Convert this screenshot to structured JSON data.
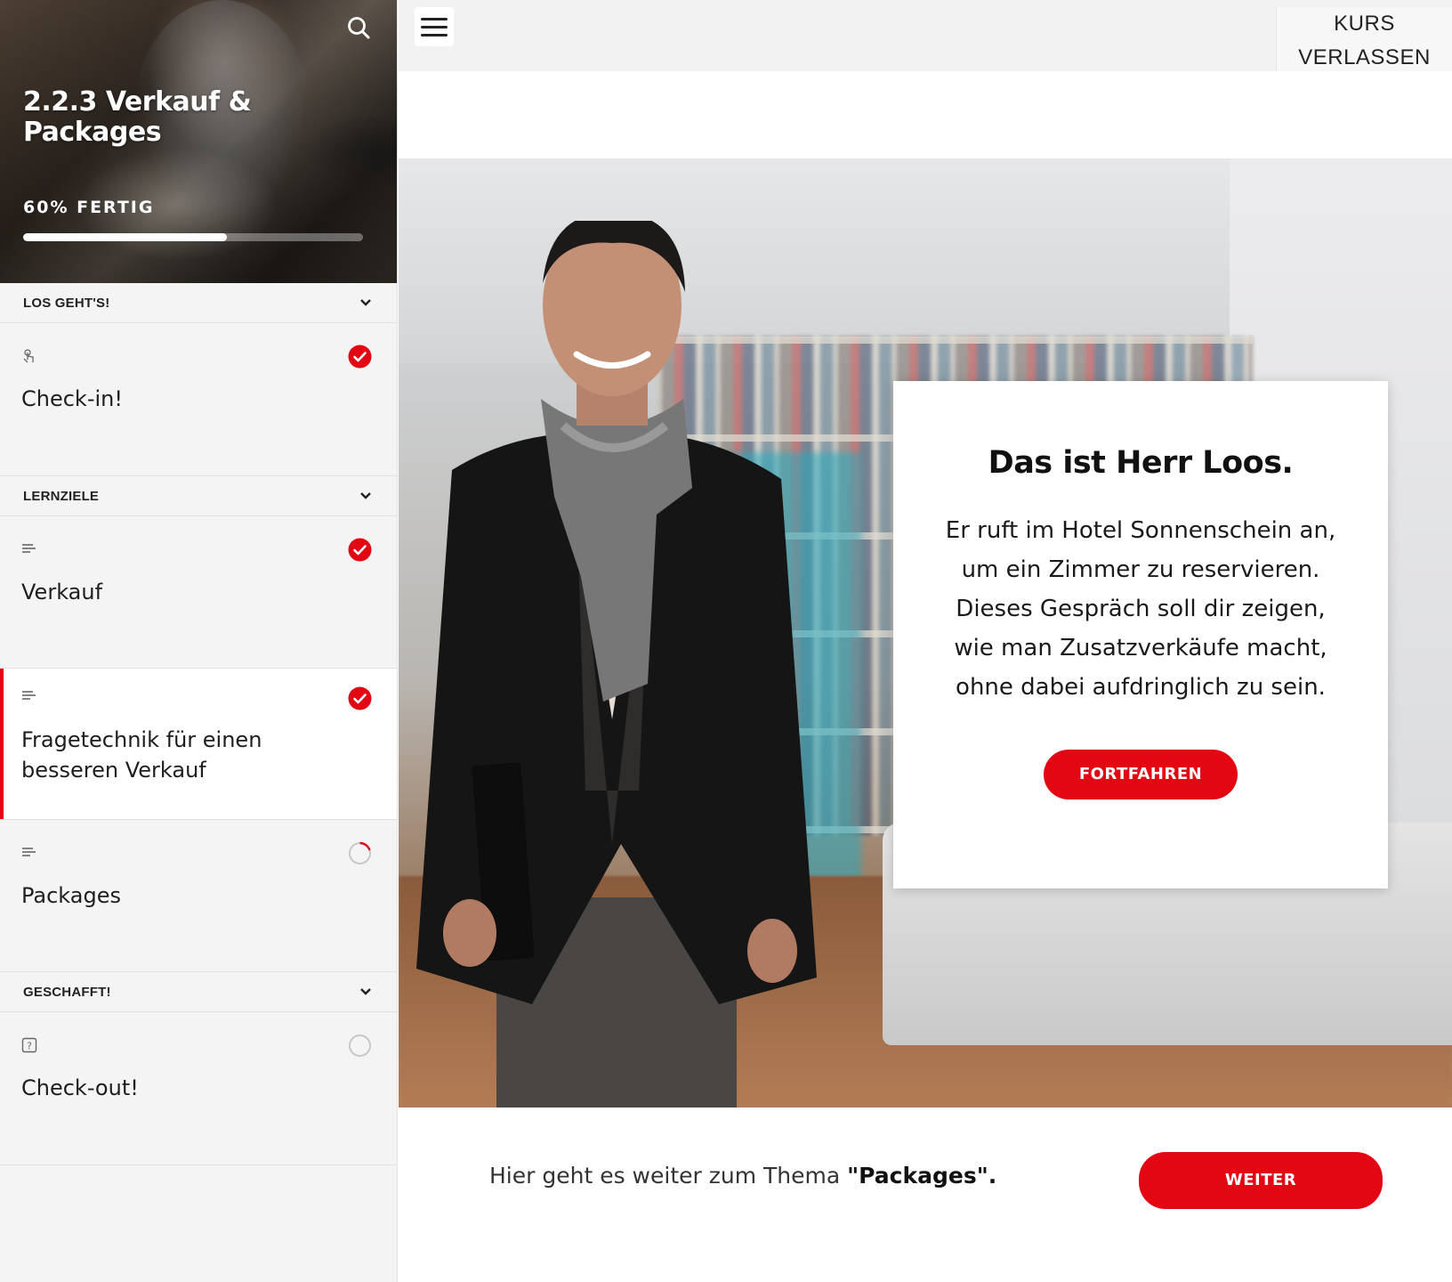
{
  "sidebar": {
    "course_title": "2.2.3 Verkauf & Packages",
    "progress_label": "60% FERTIG",
    "progress_value": 0.6,
    "sections": [
      {
        "label": "LOS GEHT'S!",
        "lessons": [
          {
            "title": "Check-in!",
            "type_icon": "touch-icon",
            "status": "complete"
          }
        ]
      },
      {
        "label": "LERNZIELE",
        "lessons": [
          {
            "title": "Verkauf",
            "type_icon": "text-lesson-icon",
            "status": "complete"
          },
          {
            "title_line1": "Fragetechnik für einen",
            "title_line2": "besseren Verkauf",
            "type_icon": "text-lesson-icon",
            "status": "complete",
            "active": true
          },
          {
            "title": "Packages",
            "type_icon": "text-lesson-icon",
            "status": "in-progress"
          }
        ]
      },
      {
        "label": "GESCHAFFT!",
        "lessons": [
          {
            "title": "Check-out!",
            "type_icon": "quiz-icon",
            "status": "not-started"
          }
        ]
      }
    ]
  },
  "topbar": {
    "menu_icon": "hamburger-icon",
    "exit_line1": "KURS",
    "exit_line2": "VERLASSEN"
  },
  "card": {
    "title": "Das ist Herr Loos.",
    "text": "Er ruft im Hotel Sonnenschein an, um ein Zimmer zu reservieren. Dieses Gespräch soll dir zeigen, wie man Zusatzverkäufe macht, ohne dabei aufdringlich zu sein.",
    "button_label": "FORTFAHREN"
  },
  "continue": {
    "text_prefix": "Hier geht es weiter zum Thema ",
    "topic": "\"Packages\".",
    "button_label": "WEITER"
  },
  "colors": {
    "accent": "#e30613",
    "sidebar_bg": "#f4f4f4",
    "topbar_bg": "#f2f2f2"
  }
}
